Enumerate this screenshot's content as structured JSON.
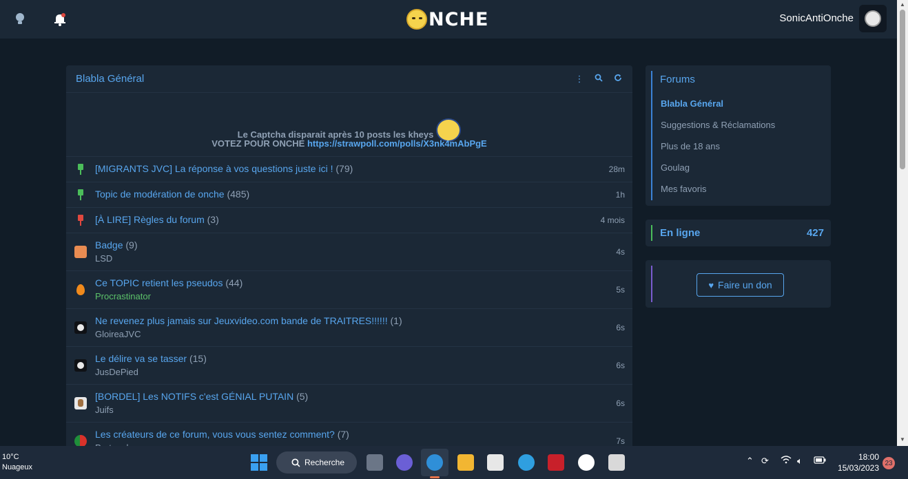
{
  "header": {
    "logo_text": "NCHE",
    "username": "SonicAntiOnche"
  },
  "main": {
    "title": "Blabla Général",
    "notice_line1": "Le Captcha disparait après 10 posts les kheys",
    "notice_line2_prefix": "VOTEZ POUR ONCHE",
    "notice_link": "https://strawpoll.com/polls/X3nk4mAbPgE",
    "topics": [
      {
        "title": "[MIGRANTS JVC] La réponse à vos questions juste ici !",
        "count": "(79)",
        "time": "28m",
        "icon": "green-pin-icon",
        "author": ""
      },
      {
        "title": "Topic de modération de onche",
        "count": "(485)",
        "time": "1h",
        "icon": "green-pin-icon",
        "author": ""
      },
      {
        "title": "[À LIRE] Règles du forum",
        "count": "(3)",
        "time": "4 mois",
        "icon": "red-pin-icon",
        "author": ""
      },
      {
        "title": "Badge",
        "count": "(9)",
        "time": "4s",
        "icon": "badge-avatar-icon",
        "author": "LSD"
      },
      {
        "title": "Ce TOPIC retient les pseudos",
        "count": "(44)",
        "time": "5s",
        "icon": "flame-icon",
        "author": "Procrastinator"
      },
      {
        "title": "Ne revenez plus jamais sur Jeuxvideo.com bande de TRAITRES!!!!!!",
        "count": "(1)",
        "time": "6s",
        "icon": "panda-avatar-icon",
        "author": "GloireaJVC"
      },
      {
        "title": "Le délire va se tasser",
        "count": "(15)",
        "time": "6s",
        "icon": "panda-avatar-icon",
        "author": "JusDePied"
      },
      {
        "title": "[BORDEL] Les NOTIFS c'est GÉNIAL PUTAIN",
        "count": "(5)",
        "time": "6s",
        "icon": "portrait-avatar-icon",
        "author": "Juifs"
      },
      {
        "title": "Les créateurs de ce forum, vous vous sentez comment?",
        "count": "(7)",
        "time": "7s",
        "icon": "portugal-flag-icon",
        "author": "Portugal"
      }
    ]
  },
  "sidebar": {
    "forums_title": "Forums",
    "forums": [
      {
        "label": "Blabla Général",
        "active": true
      },
      {
        "label": "Suggestions & Réclamations",
        "active": false
      },
      {
        "label": "Plus de 18 ans",
        "active": false
      },
      {
        "label": "Goulag",
        "active": false
      },
      {
        "label": "Mes favoris",
        "active": false
      }
    ],
    "online_label": "En ligne",
    "online_count": "427",
    "donate_label": "Faire un don"
  },
  "taskbar": {
    "temperature": "10°C",
    "weather": "Nuageux",
    "search_label": "Recherche",
    "time": "18:00",
    "date": "15/03/2023",
    "notification_count": "23"
  },
  "colors": {
    "accent": "#58a6ee",
    "panel": "#1b2836",
    "background": "#111c27",
    "online_bar": "#4bbd5a",
    "donate_bar": "#7a5cd0"
  }
}
